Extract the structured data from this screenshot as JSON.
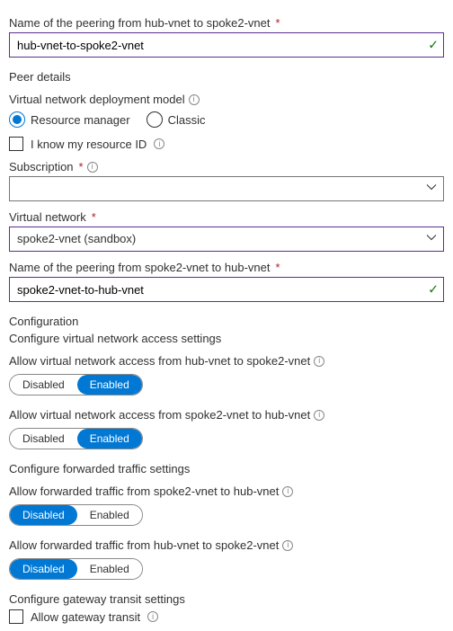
{
  "peering_name_1": {
    "label": "Name of the peering from hub-vnet to spoke2-vnet",
    "value": "hub-vnet-to-spoke2-vnet"
  },
  "peer_details": {
    "title": "Peer details",
    "deploy_model_label": "Virtual network deployment model",
    "radio_rm": "Resource manager",
    "radio_classic": "Classic",
    "know_id_label": "I know my resource ID"
  },
  "subscription": {
    "label": "Subscription",
    "value": ""
  },
  "virtual_network": {
    "label": "Virtual network",
    "value": "spoke2-vnet (sandbox)"
  },
  "peering_name_2": {
    "label": "Name of the peering from spoke2-vnet to hub-vnet",
    "value": "spoke2-vnet-to-hub-vnet"
  },
  "config": {
    "title": "Configuration",
    "vna_section": "Configure virtual network access settings",
    "vna_hub_spoke": "Allow virtual network access from hub-vnet to spoke2-vnet",
    "vna_spoke_hub": "Allow virtual network access from spoke2-vnet to hub-vnet",
    "fwd_section": "Configure forwarded traffic settings",
    "fwd_spoke_hub": "Allow forwarded traffic from spoke2-vnet to hub-vnet",
    "fwd_hub_spoke": "Allow forwarded traffic from hub-vnet to spoke2-vnet",
    "gw_section": "Configure gateway transit settings",
    "gw_label": "Allow gateway transit",
    "disabled": "Disabled",
    "enabled": "Enabled"
  }
}
